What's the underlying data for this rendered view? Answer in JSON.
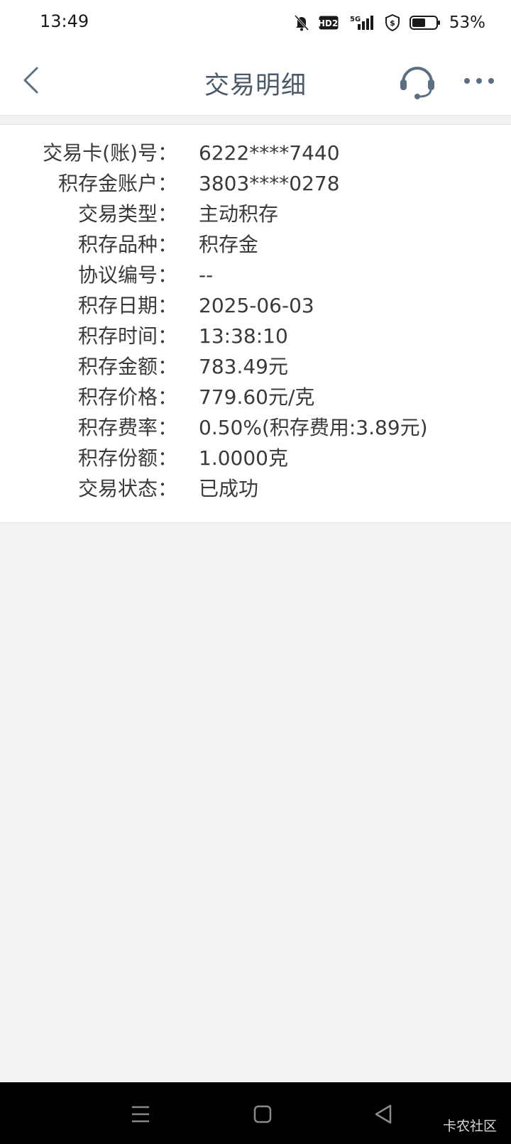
{
  "status_bar": {
    "time": "13:49",
    "battery_percent": "53%",
    "icons": [
      "mute-bell-icon",
      "hd-icon",
      "5g-signal-icon",
      "shield-icon",
      "battery-icon"
    ],
    "hd_label": "HD2",
    "network_label": "5G"
  },
  "header": {
    "title": "交易明细",
    "back_icon": "chevron-left-icon",
    "service_icon": "headset-icon",
    "more_icon": "more-dots-icon"
  },
  "details": [
    {
      "label": "交易卡(账)号：",
      "value": "6222****7440"
    },
    {
      "label": "积存金账户：",
      "value": "3803****0278"
    },
    {
      "label": "交易类型：",
      "value": "主动积存"
    },
    {
      "label": "积存品种：",
      "value": "积存金"
    },
    {
      "label": "协议编号：",
      "value": "--"
    },
    {
      "label": "积存日期：",
      "value": "2025-06-03"
    },
    {
      "label": "积存时间：",
      "value": "13:38:10"
    },
    {
      "label": "积存金额：",
      "value": "783.49元"
    },
    {
      "label": "积存价格：",
      "value": "779.60元/克"
    },
    {
      "label": "积存费率：",
      "value": "0.50%(积存费用:3.89元)"
    },
    {
      "label": "积存份额：",
      "value": "1.0000克"
    },
    {
      "label": "交易状态：",
      "value": "已成功"
    }
  ],
  "system_nav": {
    "icons": [
      "menu-icon",
      "home-square-icon",
      "back-triangle-icon"
    ]
  },
  "watermark": "卡农社区",
  "colors": {
    "title": "#4a5a6a",
    "icon": "#5a6f82",
    "background": "#f2f2f2"
  }
}
